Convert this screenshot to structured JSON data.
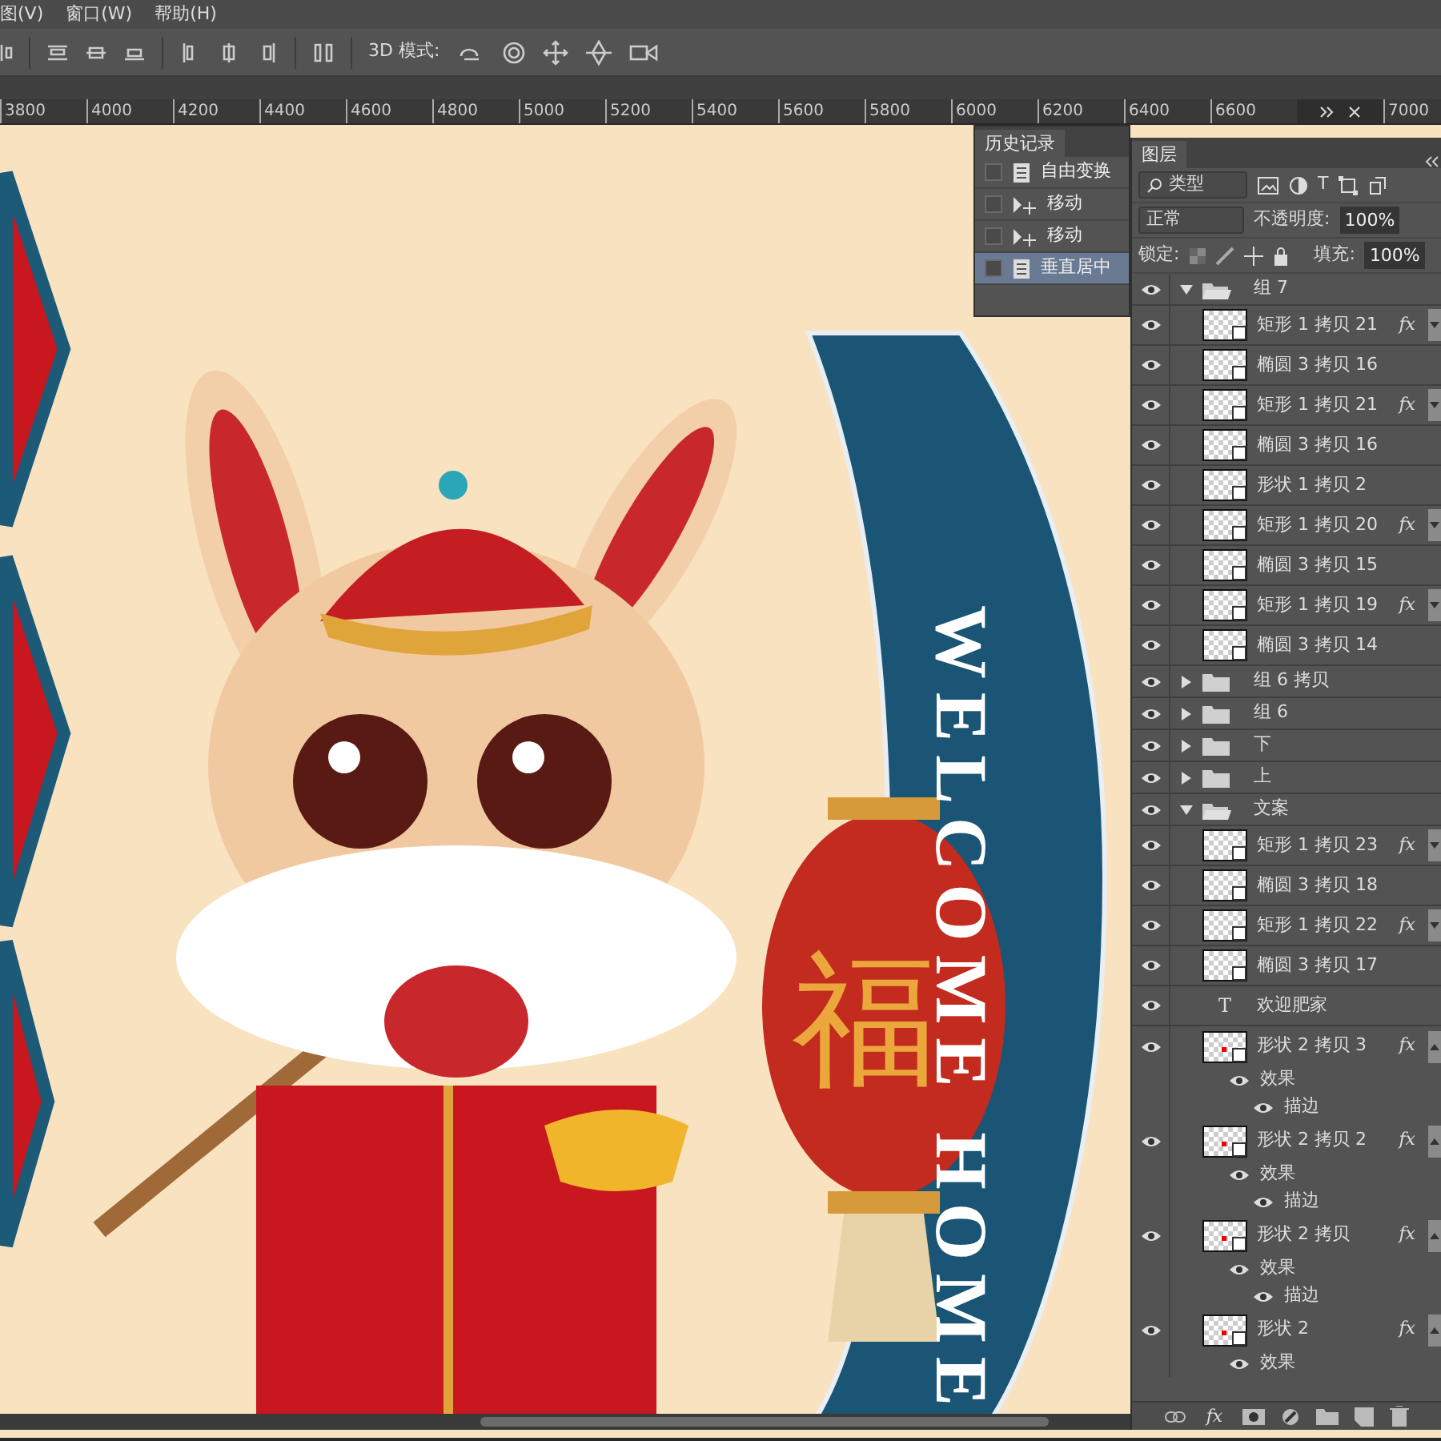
{
  "menu": [
    {
      "label": "图(V)"
    },
    {
      "label": "窗口(W)"
    },
    {
      "label": "帮助(H)"
    }
  ],
  "options_bar": {
    "mode_label": "3D 模式:"
  },
  "ruler": {
    "ticks": [
      "3800",
      "4000",
      "4200",
      "4400",
      "4600",
      "4800",
      "5000",
      "5200",
      "5400",
      "5600",
      "5800",
      "6000",
      "6200",
      "6400",
      "6600"
    ],
    "last_tick": "7000"
  },
  "canvas": {
    "ribbon_text": "WELCOME HOME",
    "lantern_text": "福"
  },
  "history_panel": {
    "title": "历史记录",
    "items": [
      {
        "kind": "transform",
        "label": "自由变换",
        "selected": false
      },
      {
        "kind": "move",
        "label": "移动",
        "selected": false
      },
      {
        "kind": "move",
        "label": "移动",
        "selected": false
      },
      {
        "kind": "transform",
        "label": "垂直居中",
        "selected": true
      }
    ]
  },
  "layers_panel": {
    "title": "图层",
    "filter": {
      "value": "类型",
      "type_glyph": "T"
    },
    "blend_mode": "正常",
    "opacity_label": "不透明度:",
    "opacity": "100%",
    "lock_label": "锁定:",
    "fill_label": "填充:",
    "fill": "100%",
    "layers": [
      {
        "kind": "group",
        "name": "组 7",
        "visible": true,
        "expanded": true,
        "children": [
          {
            "kind": "shape",
            "name": "矩形 1 拷贝 21",
            "visible": true,
            "fx": "fx",
            "expanded": false
          },
          {
            "kind": "shape",
            "name": "椭圆 3 拷贝 16",
            "visible": true
          },
          {
            "kind": "shape",
            "name": "矩形 1 拷贝 21",
            "visible": true,
            "fx": "fx",
            "expanded": false
          },
          {
            "kind": "shape",
            "name": "椭圆 3 拷贝 16",
            "visible": true
          },
          {
            "kind": "shape",
            "name": "形状 1 拷贝 2",
            "visible": true
          },
          {
            "kind": "shape",
            "name": "矩形 1 拷贝 20",
            "visible": true,
            "fx": "fx",
            "expanded": false
          },
          {
            "kind": "shape",
            "name": "椭圆 3 拷贝 15",
            "visible": true
          },
          {
            "kind": "shape",
            "name": "矩形 1 拷贝 19",
            "visible": true,
            "fx": "fx",
            "expanded": false
          },
          {
            "kind": "shape",
            "name": "椭圆 3 拷贝 14",
            "visible": true
          }
        ]
      },
      {
        "kind": "group",
        "name": "组 6 拷贝",
        "visible": true,
        "expanded": false
      },
      {
        "kind": "group",
        "name": "组 6",
        "visible": true,
        "expanded": false
      },
      {
        "kind": "group",
        "name": "下",
        "visible": true,
        "expanded": false
      },
      {
        "kind": "group",
        "name": "上",
        "visible": true,
        "expanded": false
      },
      {
        "kind": "group",
        "name": "文案",
        "visible": true,
        "expanded": true,
        "children": [
          {
            "kind": "shape",
            "name": "矩形 1 拷贝 23",
            "visible": true,
            "fx": "fx",
            "expanded": false
          },
          {
            "kind": "shape",
            "name": "椭圆 3 拷贝 18",
            "visible": true
          },
          {
            "kind": "shape",
            "name": "矩形 1 拷贝 22",
            "visible": true,
            "fx": "fx",
            "expanded": false
          },
          {
            "kind": "shape",
            "name": "椭圆 3 拷贝 17",
            "visible": true
          },
          {
            "kind": "text",
            "name": "欢迎肥家",
            "visible": true,
            "glyph": "T"
          },
          {
            "kind": "shape",
            "name": "形状 2 拷贝 3",
            "visible": true,
            "anchor": true,
            "fx": "fx",
            "expanded": true,
            "children": [
              {
                "kind": "effects",
                "name": "效果",
                "visible": true,
                "children": [
                  {
                    "kind": "effect",
                    "name": "描边",
                    "visible": true
                  }
                ]
              }
            ]
          },
          {
            "kind": "shape",
            "name": "形状 2 拷贝 2",
            "visible": true,
            "anchor": true,
            "fx": "fx",
            "expanded": true,
            "children": [
              {
                "kind": "effects",
                "name": "效果",
                "visible": true,
                "children": [
                  {
                    "kind": "effect",
                    "name": "描边",
                    "visible": true
                  }
                ]
              }
            ]
          },
          {
            "kind": "shape",
            "name": "形状 2 拷贝",
            "visible": true,
            "anchor": true,
            "fx": "fx",
            "expanded": true,
            "children": [
              {
                "kind": "effects",
                "name": "效果",
                "visible": true,
                "children": [
                  {
                    "kind": "effect",
                    "name": "描边",
                    "visible": true
                  }
                ]
              }
            ]
          },
          {
            "kind": "shape",
            "name": "形状 2",
            "visible": true,
            "anchor": true,
            "fx": "fx",
            "expanded": true,
            "children": [
              {
                "kind": "effects",
                "name": "效果",
                "visible": true
              }
            ]
          }
        ]
      }
    ],
    "footer": {
      "fx_label": "fx"
    }
  }
}
